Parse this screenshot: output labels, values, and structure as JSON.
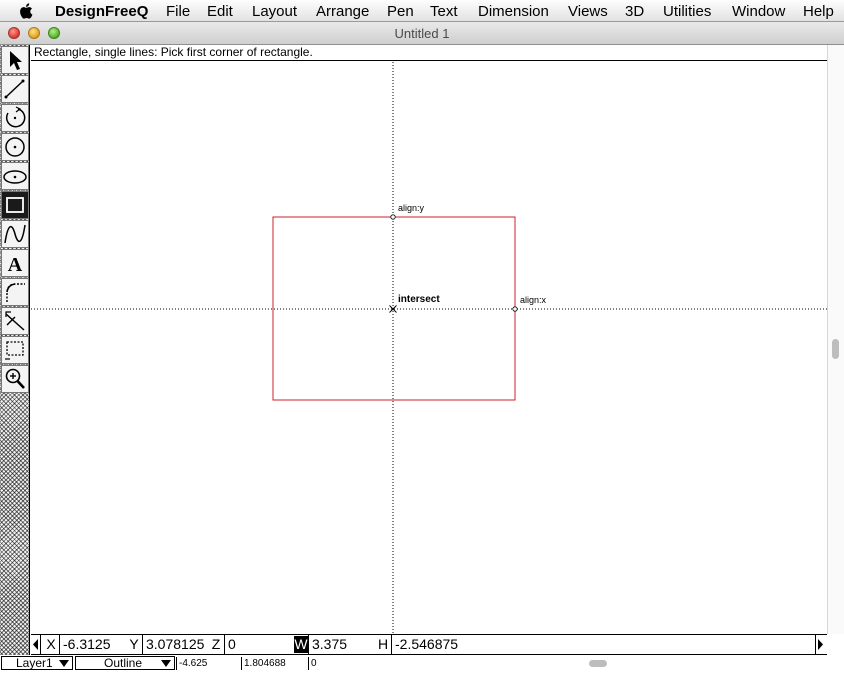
{
  "menubar": {
    "app_name": "DesignFreeQ",
    "items": [
      "File",
      "Edit",
      "Layout",
      "Arrange",
      "Pen",
      "Text",
      "Dimension",
      "Views",
      "3D",
      "Utilities",
      "Window",
      "Help"
    ]
  },
  "window": {
    "title": "Untitled 1"
  },
  "tools": [
    {
      "name": "arrow-tool-icon",
      "selected": false
    },
    {
      "name": "line-tool-icon",
      "selected": false
    },
    {
      "name": "arc-tool-icon",
      "selected": false
    },
    {
      "name": "circle-tool-icon",
      "selected": false
    },
    {
      "name": "ellipse-tool-icon",
      "selected": false
    },
    {
      "name": "rectangle-tool-icon",
      "selected": true
    },
    {
      "name": "curve-tool-icon",
      "selected": false
    },
    {
      "name": "text-tool-icon",
      "selected": false
    },
    {
      "name": "fillet-tool-icon",
      "selected": false
    },
    {
      "name": "trim-tool-icon",
      "selected": false
    },
    {
      "name": "marquee-tool-icon",
      "selected": false
    },
    {
      "name": "zoom-tool-icon",
      "selected": false
    }
  ],
  "canvas": {
    "prompt": "Rectangle, single lines: Pick first corner of rectangle.",
    "snap_labels": {
      "align_y": "align:y",
      "align_x": "align:x",
      "intersect": "intersect"
    },
    "shape_color": "#c8202a"
  },
  "coords": {
    "x_label": "X",
    "x_value": "-6.3125",
    "y_label": "Y",
    "y_value": "3.078125",
    "z_label": "Z",
    "z_value": "0",
    "w_label": "W",
    "w_value": "3.375",
    "h_label": "H",
    "h_value": "-2.546875"
  },
  "status": {
    "layer": "Layer1",
    "view_mode": "Outline",
    "field1": "-4.625",
    "field2": "1.804688",
    "field3": "0"
  }
}
